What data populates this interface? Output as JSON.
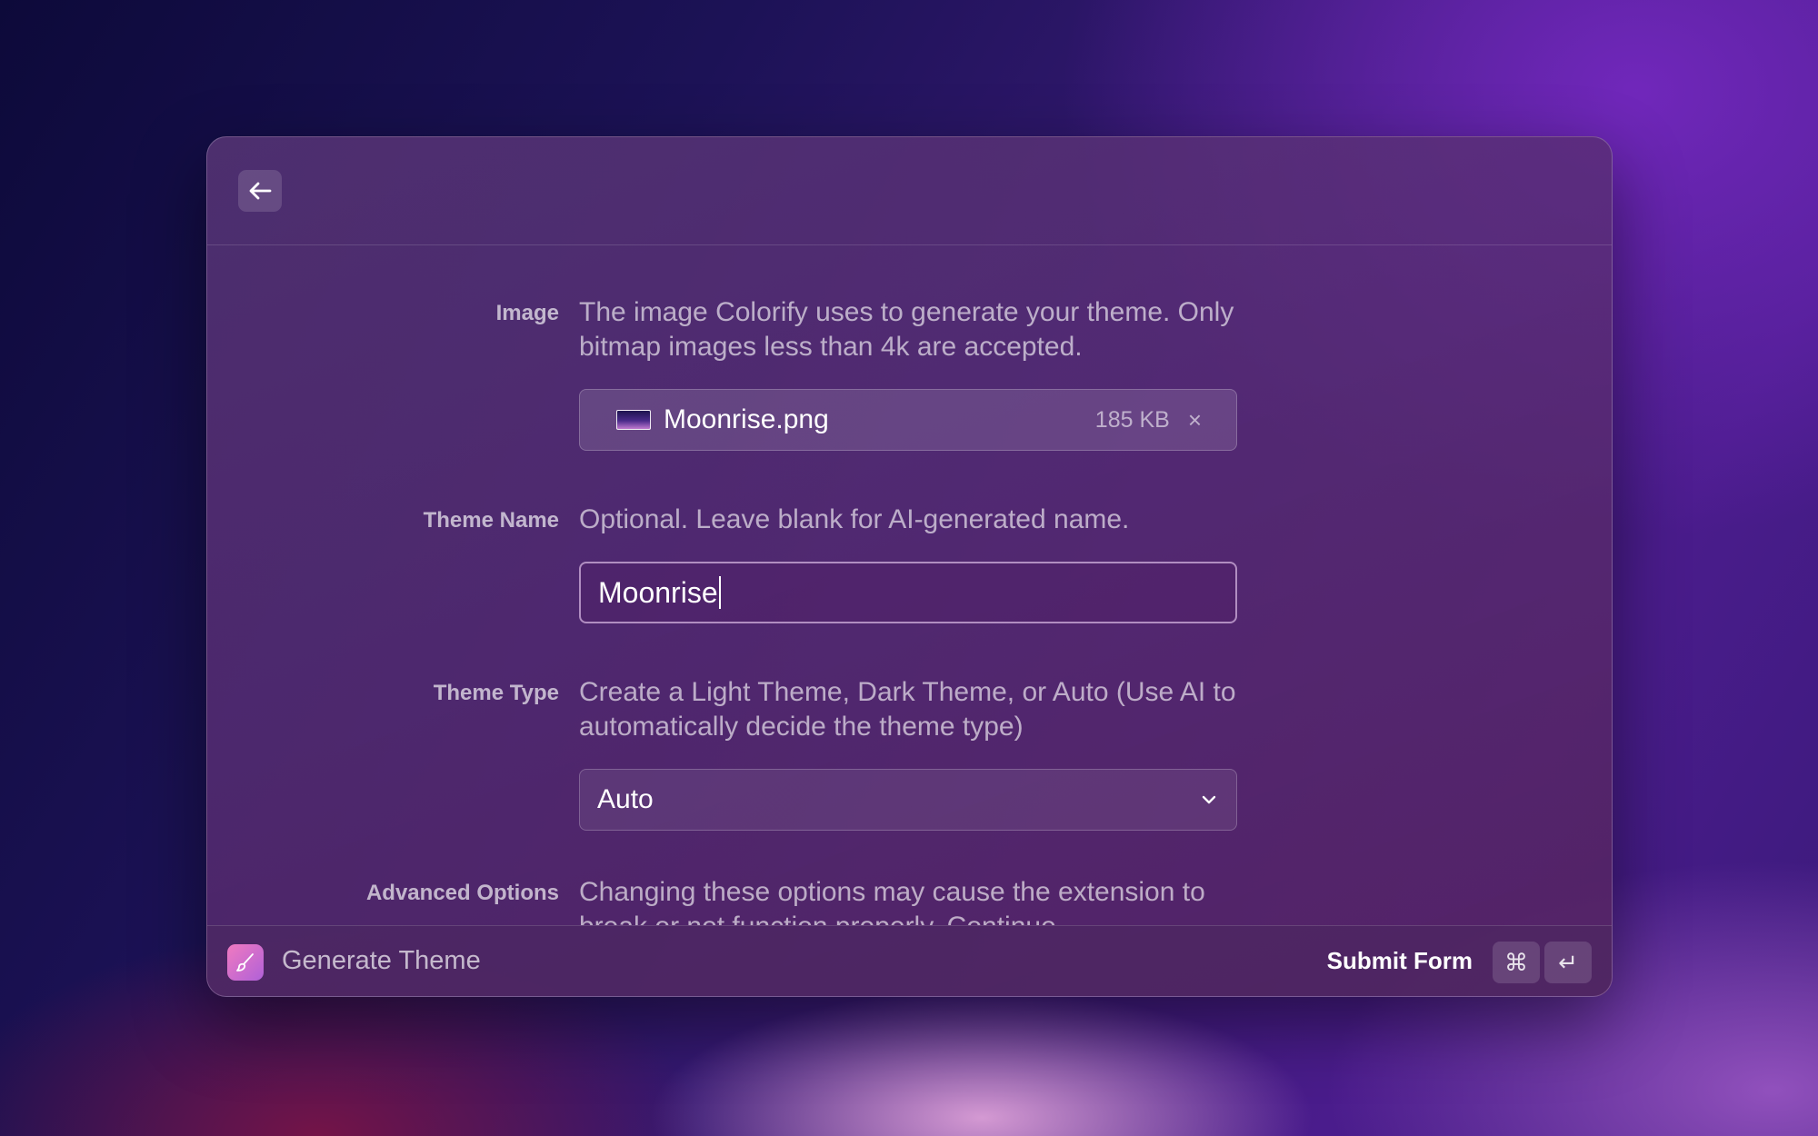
{
  "header": {
    "back_icon": "arrow-left-icon"
  },
  "form": {
    "image": {
      "label": "Image",
      "description": "The image Colorify uses to generate your theme. Only bitmap images less than 4k are accepted.",
      "file_name": "Moonrise.png",
      "file_size": "185 KB",
      "remove_symbol": "×"
    },
    "theme_name": {
      "label": "Theme Name",
      "description": "Optional. Leave blank for AI-generated name.",
      "value": "Moonrise"
    },
    "theme_type": {
      "label": "Theme Type",
      "description": "Create a Light Theme, Dark Theme, or Auto (Use AI to automatically decide the theme type)",
      "selected": "Auto"
    },
    "advanced": {
      "label": "Advanced Options",
      "description": "Changing these options may cause the extension to break or not function properly. Continue"
    }
  },
  "footer": {
    "app_icon": "paintbrush-icon",
    "title": "Generate Theme",
    "submit_label": "Submit Form",
    "shortcut_cmd": "⌘",
    "shortcut_enter": "↵"
  },
  "colors": {
    "accent_gradient_start": "#f07ac0",
    "accent_gradient_end": "#b061d8"
  }
}
